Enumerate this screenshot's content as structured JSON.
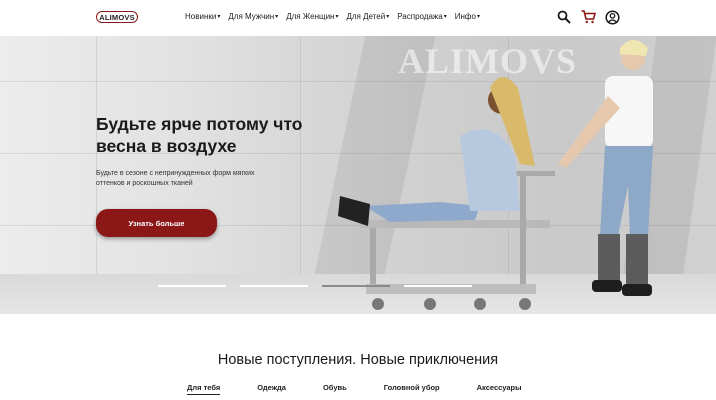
{
  "header": {
    "logo": "ALIMOVS",
    "nav": [
      {
        "label": "Новинки"
      },
      {
        "label": "Для Мужчин"
      },
      {
        "label": "Для Женщин"
      },
      {
        "label": "Для Детей"
      },
      {
        "label": "Распродажа"
      },
      {
        "label": "Инфо"
      }
    ],
    "icons": [
      "search-icon",
      "cart-icon",
      "account-icon"
    ]
  },
  "hero": {
    "watermark": "ALIMOVS",
    "title": "Будьте ярче потому что весна в воздухе",
    "subtitle": "Будьте в сезоне с непринужденных форм мягких оттенков и роскошных тканей",
    "button": "Узнать больше",
    "slides": 4,
    "active_slide": 3,
    "accent_color": "#8b1717"
  },
  "section": {
    "title": "Новые поступления. Новые приключения",
    "tabs": [
      {
        "label": "Для тебя",
        "active": true
      },
      {
        "label": "Одежда",
        "active": false
      },
      {
        "label": "Обувь",
        "active": false
      },
      {
        "label": "Головной убор",
        "active": false
      },
      {
        "label": "Аксессуары",
        "active": false
      }
    ]
  }
}
